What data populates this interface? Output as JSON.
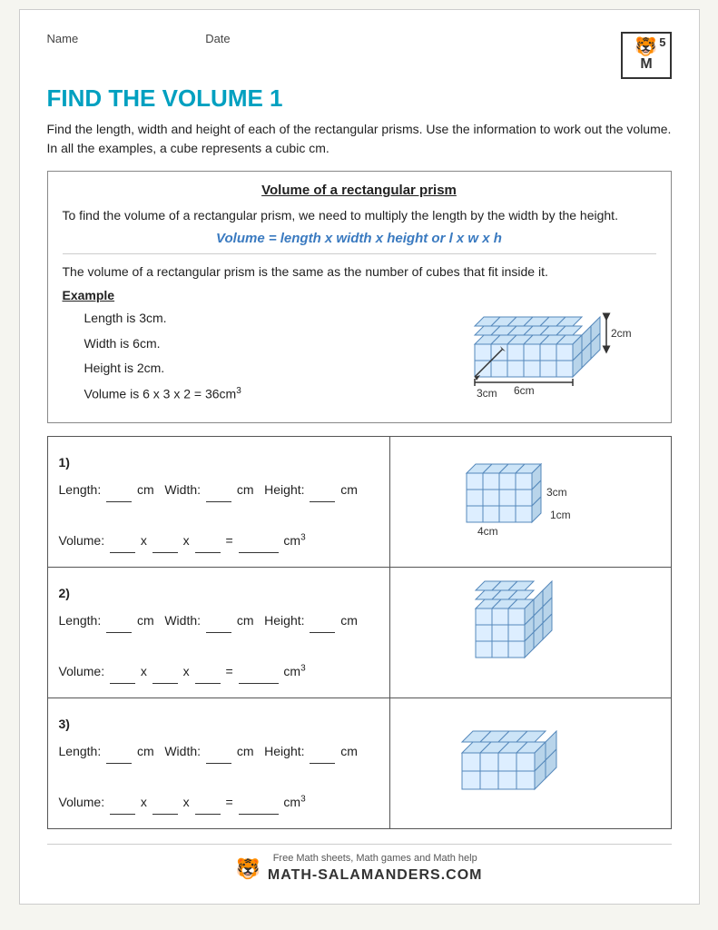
{
  "header": {
    "name_label": "Name",
    "date_label": "Date",
    "logo_number": "5",
    "logo_letter": "M"
  },
  "title": "FIND THE VOLUME 1",
  "intro": "Find the length, width and height of each of the rectangular prisms. Use the information to work out the volume. In all the examples, a cube represents a cubic cm.",
  "info_box": {
    "title": "Volume of a rectangular prism",
    "description1": "To find the volume of a rectangular prism, we need to multiply the length by the width by the height.",
    "formula": "Volume = length x width x height or l x w x h",
    "cube_note": "The volume of a rectangular prism is the same as the number of cubes that fit inside it."
  },
  "example": {
    "label": "Example",
    "length": "Length is 3cm.",
    "width": "Width is 6cm.",
    "height": "Height is 2cm.",
    "volume": "Volume is 6 x 3 x 2 = 36cm³",
    "dim_3cm": "3cm",
    "dim_6cm": "6cm",
    "dim_2cm": "2cm"
  },
  "problems": [
    {
      "number": "1)",
      "length_label": "Length:",
      "width_label": "Width:",
      "height_label": "Height:",
      "cm": "cm",
      "volume_label": "Volume:",
      "equals": "=",
      "cm3": "cm³",
      "dim_4cm": "4cm",
      "dim_3cm": "3cm",
      "dim_1cm": "1cm"
    },
    {
      "number": "2)",
      "length_label": "Length:",
      "width_label": "Width:",
      "height_label": "Height:",
      "cm": "cm",
      "volume_label": "Volume:",
      "equals": "=",
      "cm3": "cm³"
    },
    {
      "number": "3)",
      "length_label": "Length:",
      "width_label": "Width:",
      "height_label": "Height:",
      "cm": "cm",
      "volume_label": "Volume:",
      "equals": "=",
      "cm3": "cm³"
    }
  ],
  "footer": {
    "tagline": "Free Math sheets, Math games and Math help",
    "site": "MATH-SALAMANDERS.COM"
  }
}
